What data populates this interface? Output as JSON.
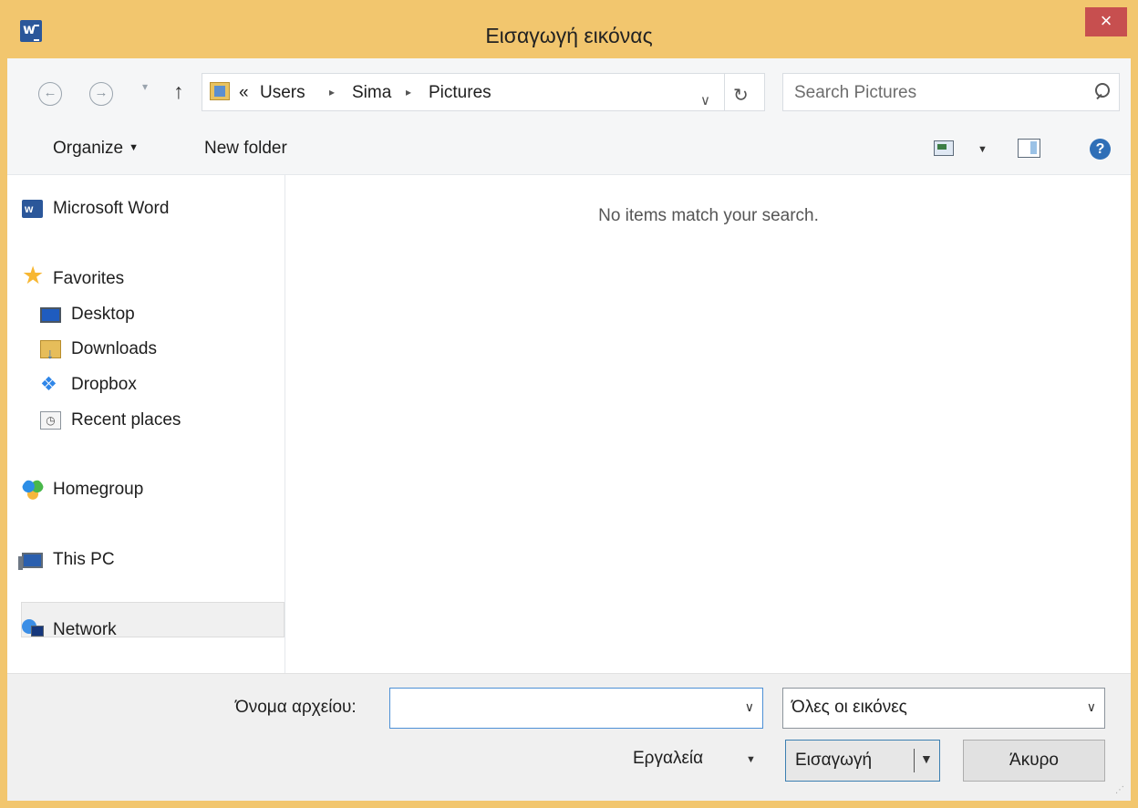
{
  "window": {
    "title": "Εισαγωγή εικόνας",
    "close_symbol": "×",
    "app_icon": "word-icon"
  },
  "navigation": {
    "back_symbol": "←",
    "forward_symbol": "→",
    "history_symbol": "▾",
    "up_symbol": "↑",
    "breadcrumbs": [
      "«",
      "Users",
      "Sima",
      "Pictures"
    ],
    "separator_symbol": "▸",
    "dropdown_symbol": "∨",
    "refresh_symbol": "↻",
    "search_placeholder": "Search Pictures"
  },
  "toolbar": {
    "organize_label": "Organize",
    "new_folder_label": "New folder",
    "help_symbol": "?"
  },
  "sidebar": {
    "items": [
      {
        "label": "Microsoft Word",
        "icon": "word-icon"
      },
      {
        "label": "Favorites",
        "icon": "star-icon"
      },
      {
        "label": "Desktop",
        "icon": "desktop-icon"
      },
      {
        "label": "Downloads",
        "icon": "downloads-icon"
      },
      {
        "label": "Dropbox",
        "icon": "dropbox-icon"
      },
      {
        "label": "Recent places",
        "icon": "recent-places-icon"
      },
      {
        "label": "Homegroup",
        "icon": "homegroup-icon"
      },
      {
        "label": "This PC",
        "icon": "computer-icon"
      },
      {
        "label": "Network",
        "icon": "network-icon"
      }
    ]
  },
  "main": {
    "empty_message": "No items match your search."
  },
  "footer": {
    "file_name_label": "Όνομα αρχείου:",
    "file_name_value": "",
    "file_type_value": "Όλες οι εικόνες",
    "tools_label": "Εργαλεία",
    "insert_label": "Εισαγωγή",
    "cancel_label": "Άκυρο",
    "dropdown_symbol": "∨"
  },
  "colors": {
    "title_bar": "#f2c66e",
    "close_button": "#c74f4f",
    "focus_border": "#4d90d6"
  }
}
